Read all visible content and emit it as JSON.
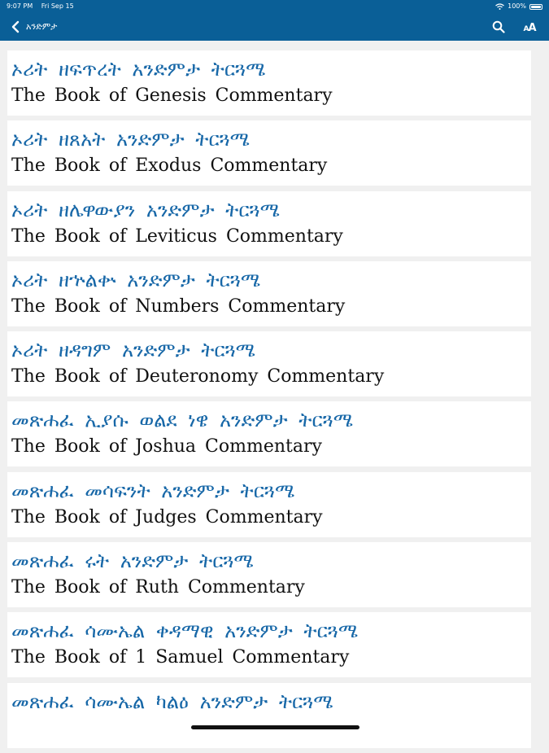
{
  "status_bar": {
    "time": "9:07 PM",
    "date": "Fri Sep 15",
    "battery_percent": "100%"
  },
  "nav": {
    "title": "አንድምታ",
    "icons": {
      "back": "chevron-left-icon",
      "search": "search-icon",
      "font_size": "font-size-icon"
    }
  },
  "books": [
    {
      "geez": "ኦሪት ዘፍጥረት አንድምታ ትርጓሜ",
      "english": "The Book of Genesis Commentary"
    },
    {
      "geez": "ኦሪት ዘጸአት አንድምታ ትርጓሜ",
      "english": "The Book of Exodus Commentary"
    },
    {
      "geez": "ኦሪት ዘሌዋውያን አንድምታ ትርጓሜ",
      "english": "The Book of Leviticus Commentary"
    },
    {
      "geez": "ኦሪት ዘኍልቍ አንድምታ ትርጓሜ",
      "english": "The Book of Numbers Commentary"
    },
    {
      "geez": "ኦሪት ዘዳግም አንድምታ ትርጓሜ",
      "english": "The Book of Deuteronomy Commentary"
    },
    {
      "geez": "መጽሐፈ ኢያሱ ወልደ ነዌ አንድምታ ትርጓሜ",
      "english": "The Book of Joshua Commentary"
    },
    {
      "geez": "መጽሐፈ መሳፍንት አንድምታ ትርጓሜ",
      "english": "The Book of Judges Commentary"
    },
    {
      "geez": "መጽሐፈ ሩት አንድምታ ትርጓሜ",
      "english": "The Book of Ruth Commentary"
    },
    {
      "geez": "መጽሐፈ ሳሙኤል ቀዳማዊ አንድምታ ትርጓሜ",
      "english": "The Book of 1 Samuel Commentary"
    },
    {
      "geez": "መጽሐፈ ሳሙኤል ካልዕ አንድምታ ትርጓሜ",
      "english": ""
    }
  ],
  "colors": {
    "header": "#0a5f97",
    "geez_title": "#1868a8",
    "english_title": "#111111",
    "background": "#f0f0f0",
    "card": "#ffffff"
  }
}
